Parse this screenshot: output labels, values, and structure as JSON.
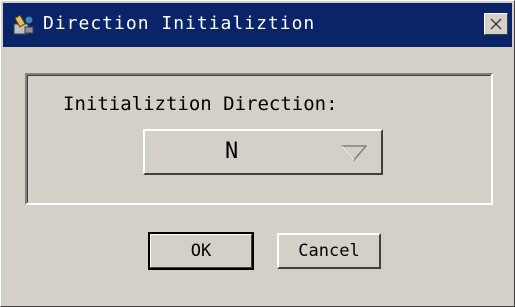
{
  "window": {
    "title": "Direction Initializtion",
    "close_label": "×"
  },
  "group": {
    "label": "Initializtion Direction:"
  },
  "direction_select": {
    "value": "N"
  },
  "buttons": {
    "ok": "OK",
    "cancel": "Cancel"
  },
  "colors": {
    "titlebar": "#0a246a",
    "face": "#d4d0c8"
  },
  "icons": {
    "title": "app-tools-icon",
    "close": "close-icon",
    "dropdown": "chevron-down-icon"
  }
}
